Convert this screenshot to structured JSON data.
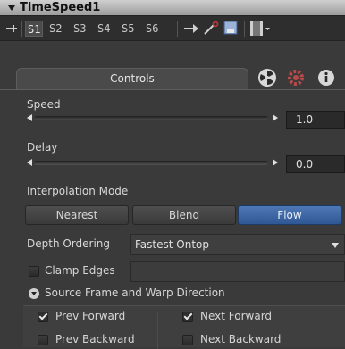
{
  "header": {
    "title": "TimeSpeed1"
  },
  "toolbar": {
    "s1": "S1",
    "s2": "S2",
    "s3": "S3",
    "s4": "S4",
    "s5": "S5",
    "s6": "S6"
  },
  "tabs": {
    "controls": "Controls"
  },
  "speed": {
    "label": "Speed",
    "value": "1.0"
  },
  "delay": {
    "label": "Delay",
    "value": "0.0"
  },
  "interpolation": {
    "label": "Interpolation Mode",
    "options": [
      "Nearest",
      "Blend",
      "Flow"
    ],
    "selected": "Flow"
  },
  "depth": {
    "label": "Depth Ordering",
    "value": "Fastest Ontop"
  },
  "clamp": {
    "label": "Clamp Edges"
  },
  "source": {
    "label": "Source Frame and Warp Direction",
    "prev_forward": "Prev Forward",
    "next_forward": "Next Forward",
    "prev_backward": "Prev Backward",
    "next_backward": "Next Backward"
  },
  "colors": {
    "accent": "#3a68a8",
    "header": "#bdbdbd",
    "bg": "#3a3a3a"
  }
}
